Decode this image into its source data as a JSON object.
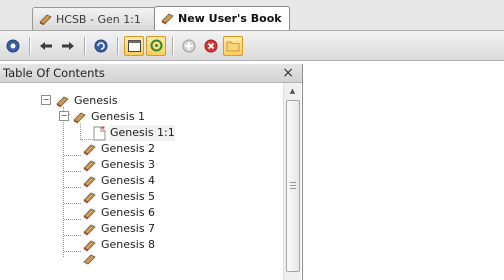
{
  "tabs": [
    {
      "label": "HCSB - Gen 1:1"
    },
    {
      "label": "New User's Book"
    }
  ],
  "toolbar": {
    "buttons": [
      {
        "icon": "help-circle-icon"
      },
      {
        "icon": "back-arrow-icon"
      },
      {
        "icon": "forward-arrow-icon"
      },
      {
        "icon": "sync-icon"
      },
      {
        "icon": "single-pane-icon",
        "active": true
      },
      {
        "icon": "gear-icon",
        "active": true
      },
      {
        "icon": "add-icon"
      },
      {
        "icon": "delete-icon"
      },
      {
        "icon": "folder-icon",
        "active": true
      }
    ]
  },
  "panel": {
    "title": "Table Of Contents",
    "close": "×"
  },
  "tree": [
    {
      "label": "Genesis",
      "level": 1,
      "expanded": true
    },
    {
      "label": "Genesis 1",
      "level": 2,
      "expanded": true
    },
    {
      "label": "Genesis 1:1",
      "level": 3,
      "selected": true
    },
    {
      "label": "Genesis 2",
      "level": 2
    },
    {
      "label": "Genesis 3",
      "level": 2
    },
    {
      "label": "Genesis 4",
      "level": 2
    },
    {
      "label": "Genesis 5",
      "level": 2
    },
    {
      "label": "Genesis 6",
      "level": 2
    },
    {
      "label": "Genesis 7",
      "level": 2
    },
    {
      "label": "Genesis 8",
      "level": 2
    }
  ],
  "colors": {
    "book_red": "#b33a2a",
    "book_tan": "#c69b5b",
    "active_button": "#ffcf5a"
  }
}
